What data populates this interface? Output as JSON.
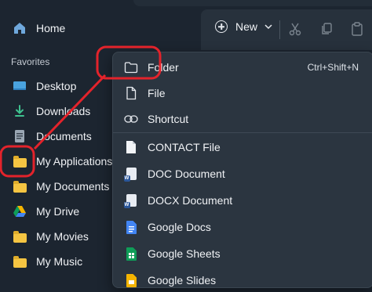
{
  "sidebar": {
    "home_label": "Home",
    "section_title": "Favorites",
    "items": [
      {
        "label": "Desktop"
      },
      {
        "label": "Downloads"
      },
      {
        "label": "Documents"
      },
      {
        "label": "My Applications"
      },
      {
        "label": "My Documents"
      },
      {
        "label": "My Drive"
      },
      {
        "label": "My Movies"
      },
      {
        "label": "My Music"
      }
    ]
  },
  "toolbar": {
    "new_label": "New"
  },
  "new_menu": {
    "items": [
      {
        "label": "Folder",
        "shortcut": "Ctrl+Shift+N"
      },
      {
        "label": "File"
      },
      {
        "label": "Shortcut"
      },
      {
        "label": "CONTACT File"
      },
      {
        "label": "DOC Document"
      },
      {
        "label": "DOCX Document"
      },
      {
        "label": "Google Docs"
      },
      {
        "label": "Google Sheets"
      },
      {
        "label": "Google Slides"
      }
    ]
  },
  "colors": {
    "background": "#1c2530",
    "menu_background": "#2b3540",
    "annotation_red": "#e3232b",
    "folder_yellow": "#f5c542"
  }
}
